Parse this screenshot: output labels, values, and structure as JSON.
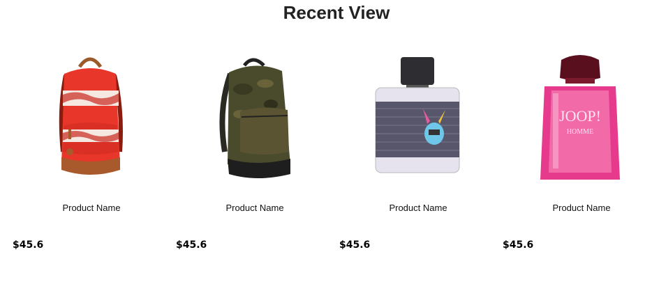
{
  "section": {
    "title": "Recent View"
  },
  "products": [
    {
      "name": "Product Name",
      "price": "$45.6",
      "image": "red-backpack-image"
    },
    {
      "name": "Product Name",
      "price": "$45.6",
      "image": "camo-backpack-image"
    },
    {
      "name": "Product Name",
      "price": "$45.6",
      "image": "perfume-bottle-image"
    },
    {
      "name": "Product Name",
      "price": "$45.6",
      "image": "pink-cologne-image"
    }
  ]
}
